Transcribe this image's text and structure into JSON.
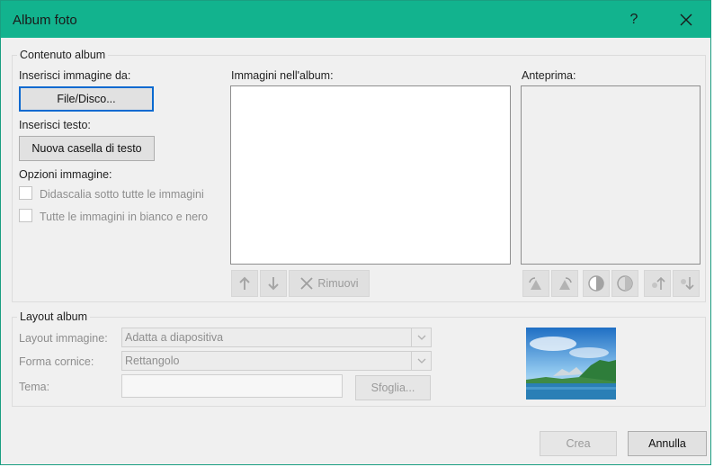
{
  "window": {
    "title": "Album foto",
    "help_label": "?",
    "close_label": "✕",
    "accent": "#12b38e"
  },
  "content": {
    "legend": "Contenuto album",
    "insert_image_label": "Inserisci immagine da:",
    "file_disk_button": "File/Disco...",
    "insert_text_label": "Inserisci testo:",
    "new_textbox_button": "Nuova casella di testo",
    "image_options_label": "Opzioni immagine:",
    "caption_option": "Didascalia sotto tutte le immagini",
    "bw_option": "Tutte le immagini in bianco e nero",
    "album_images_label": "Immagini nell'album:",
    "remove_button": "Rimuovi",
    "preview_label": "Anteprima:"
  },
  "layout": {
    "legend": "Layout album",
    "picture_layout_label": "Layout immagine:",
    "picture_layout_value": "Adatta a diapositiva",
    "frame_shape_label": "Forma cornice:",
    "frame_shape_value": "Rettangolo",
    "theme_label": "Tema:",
    "theme_value": "",
    "browse_button": "Sfoglia..."
  },
  "footer": {
    "create_button": "Crea",
    "cancel_button": "Annulla"
  },
  "icons": [
    "help-icon",
    "close-icon",
    "arrow-up-icon",
    "arrow-down-icon",
    "remove-x-icon",
    "rotate-left-icon",
    "rotate-right-icon",
    "contrast-more-icon",
    "contrast-less-icon",
    "brightness-more-icon",
    "brightness-less-icon",
    "dropdown-arrow-icon"
  ]
}
